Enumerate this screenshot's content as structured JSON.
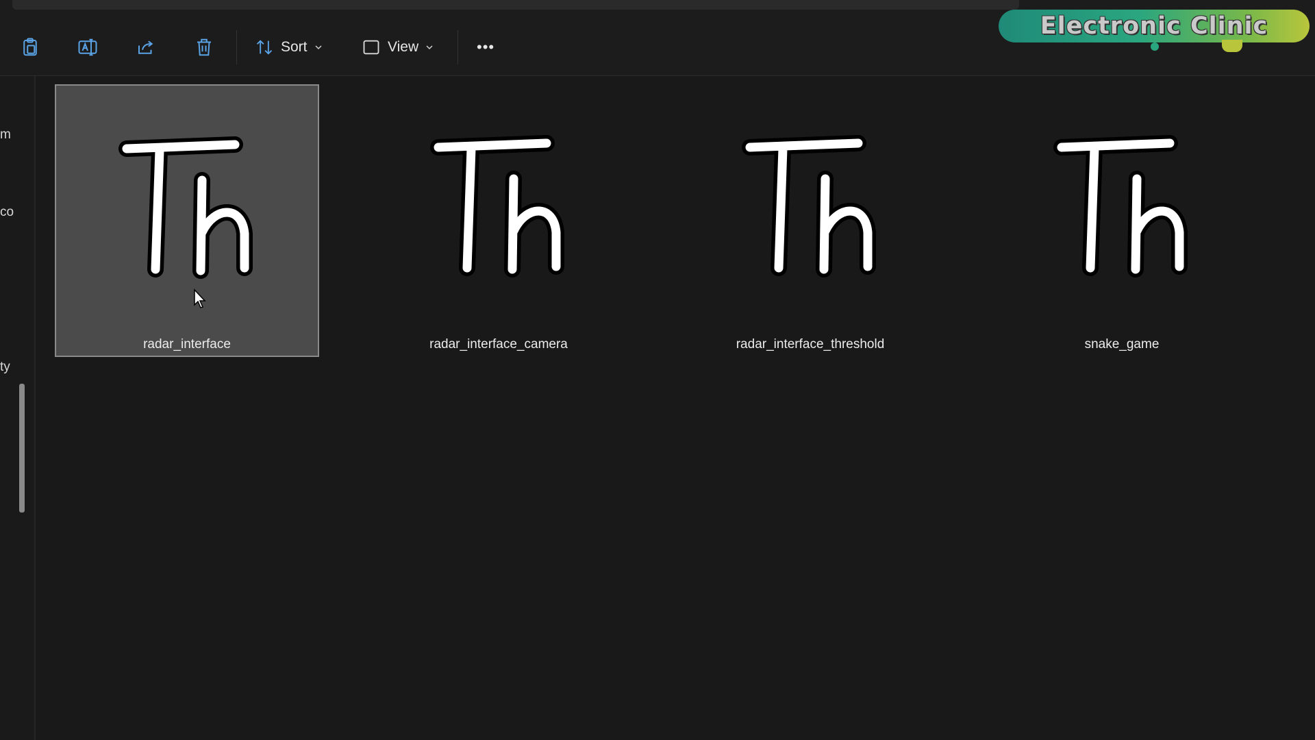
{
  "toolbar": {
    "icons": [
      "paste-icon",
      "rename-icon",
      "share-icon",
      "delete-icon"
    ],
    "sort_label": "Sort",
    "view_label": "View",
    "more_label": "•••"
  },
  "watermark": {
    "text": "Electronic Clinic"
  },
  "sidebar": {
    "fragments": [
      "m",
      "co",
      "ty"
    ]
  },
  "files": [
    {
      "name": "radar_interface",
      "selected": true,
      "icon": "text-file-icon"
    },
    {
      "name": "radar_interface_camera",
      "selected": false,
      "icon": "text-file-icon"
    },
    {
      "name": "radar_interface_threshold",
      "selected": false,
      "icon": "text-file-icon"
    },
    {
      "name": "snake_game",
      "selected": false,
      "icon": "text-file-icon"
    }
  ],
  "colors": {
    "background": "#191919",
    "selection": "#4b4b4b",
    "brand_start": "#1f8a78",
    "brand_end": "#b9c63c"
  }
}
